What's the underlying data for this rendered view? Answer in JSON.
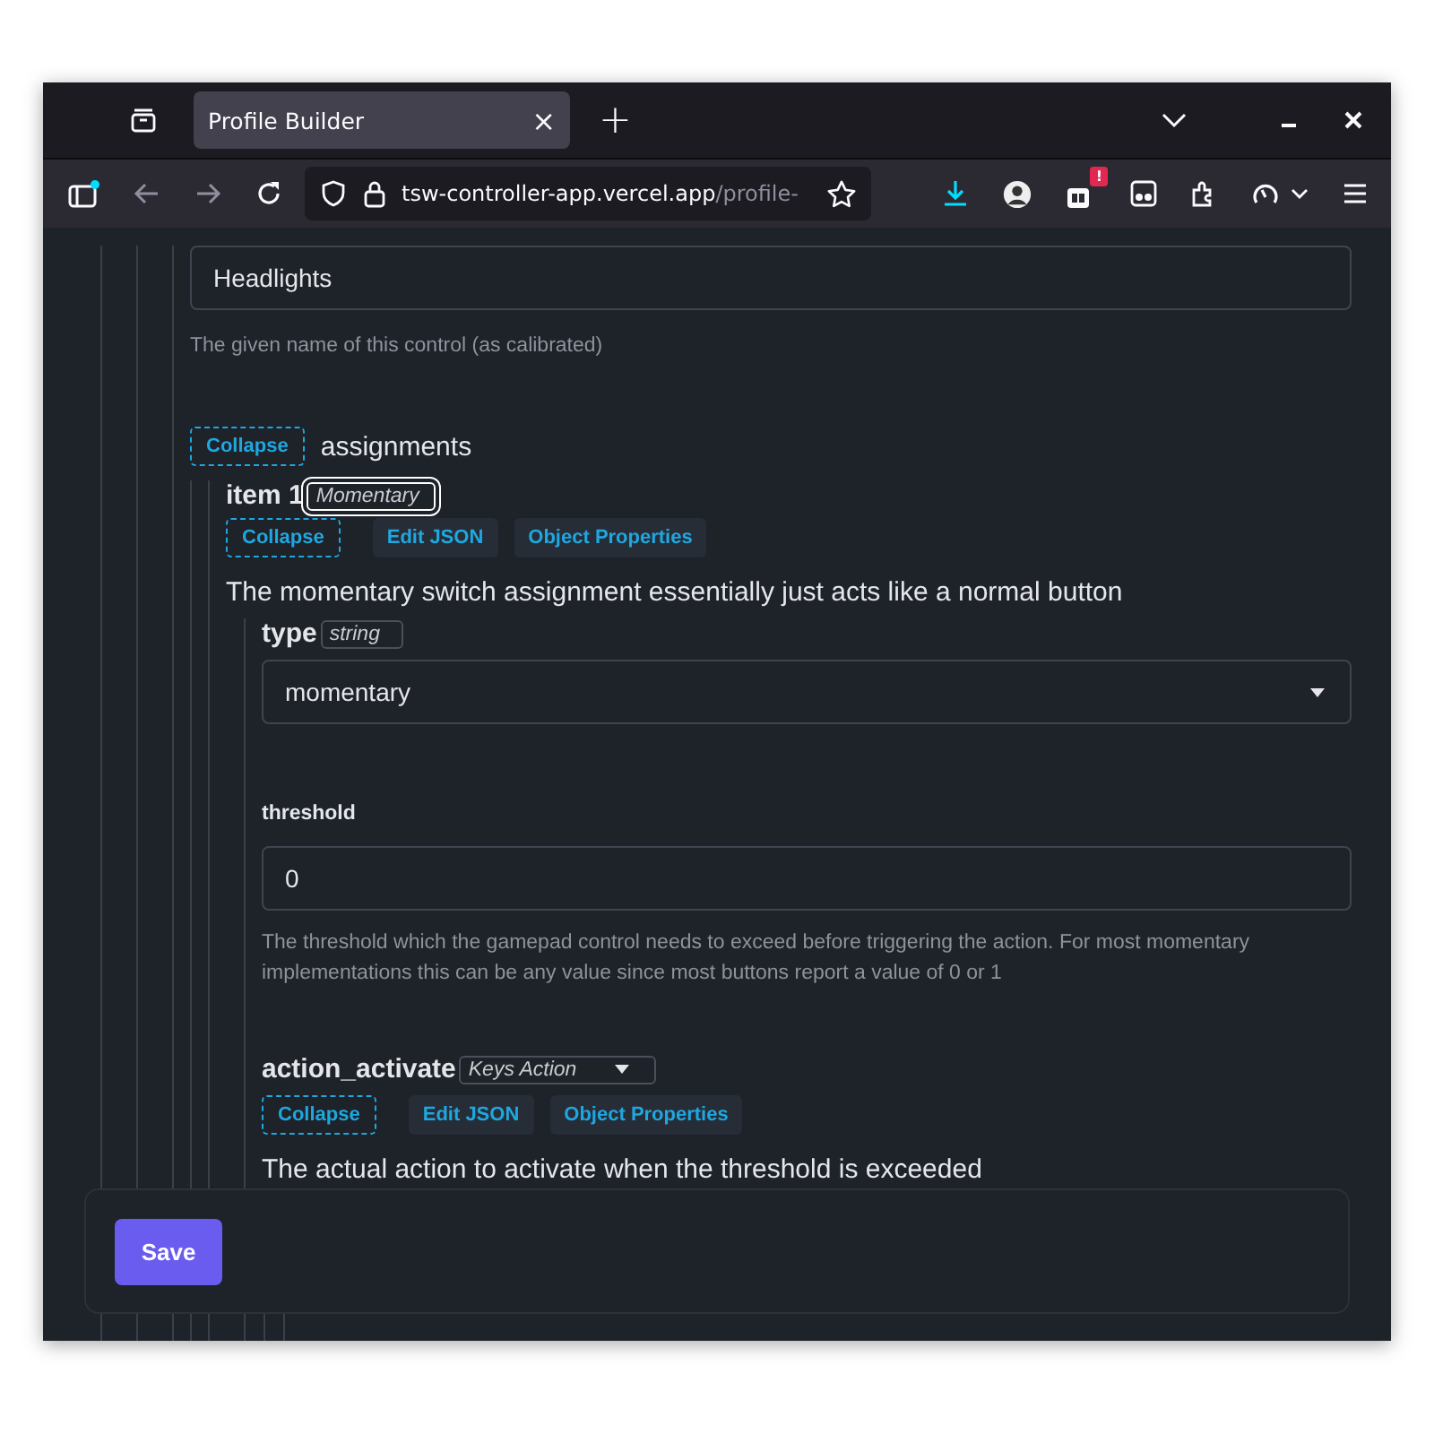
{
  "browser": {
    "tab": {
      "title": "Profile Builder",
      "close": "×"
    },
    "new_tab": "+",
    "url": {
      "host": "tsw-controller-app.vercel.app",
      "path": "/profile-"
    },
    "badge": "!"
  },
  "form": {
    "name_field": {
      "value": "Headlights",
      "help": "The given name of this control (as calibrated)"
    },
    "assignments": {
      "collapse": "Collapse",
      "title": "assignments",
      "items": [
        {
          "title": "item 1",
          "type_select": {
            "value": "Momentary",
            "focused": true
          },
          "buttons": [
            "Collapse",
            "Edit JSON",
            "Object Properties"
          ],
          "description": "The momentary switch assignment essentially just acts like a normal button",
          "properties": [
            {
              "kind": "select",
              "name": "type",
              "type_badge": "string",
              "value": "momentary"
            },
            {
              "kind": "input",
              "name": "threshold",
              "value": "0",
              "help": "The threshold which the gamepad control needs to exceed before triggering the action. For most momentary implementations this can be any value since most buttons report a value of 0 or 1"
            },
            {
              "kind": "object",
              "name": "action_activate",
              "type_select": {
                "value": "Keys Action",
                "focused": false
              },
              "buttons": [
                "Collapse",
                "Edit JSON",
                "Object Properties"
              ],
              "description": "The actual action to activate when the threshold is exceeded"
            }
          ]
        }
      ]
    }
  },
  "save_button": "Save"
}
